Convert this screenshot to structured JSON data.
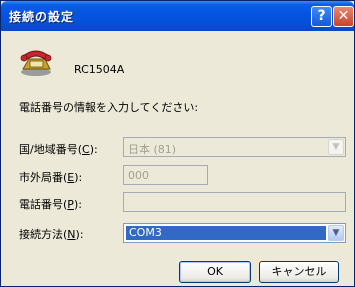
{
  "window": {
    "title": "接続の設定",
    "help_label": "?",
    "close_label": "✕"
  },
  "connection": {
    "icon": "phone-icon",
    "name": "RC1504A"
  },
  "instruction": "電話番号の情報を入力してください:",
  "fields": {
    "country": {
      "label": "国/地域番号(",
      "accel": "C",
      "suffix": "):",
      "value": "日本 (81)"
    },
    "area": {
      "label": "市外局番(",
      "accel": "E",
      "suffix": "):",
      "value": "000"
    },
    "phone": {
      "label": "電話番号(",
      "accel": "P",
      "suffix": "):",
      "value": ""
    },
    "method": {
      "label": "接続方法(",
      "accel": "N",
      "suffix": "):",
      "value": "COM3"
    }
  },
  "buttons": {
    "ok": "OK",
    "cancel": "キャンセル"
  },
  "colors": {
    "titlebar": "#0554e3",
    "selection": "#316ac5",
    "face": "#ece9d8"
  }
}
